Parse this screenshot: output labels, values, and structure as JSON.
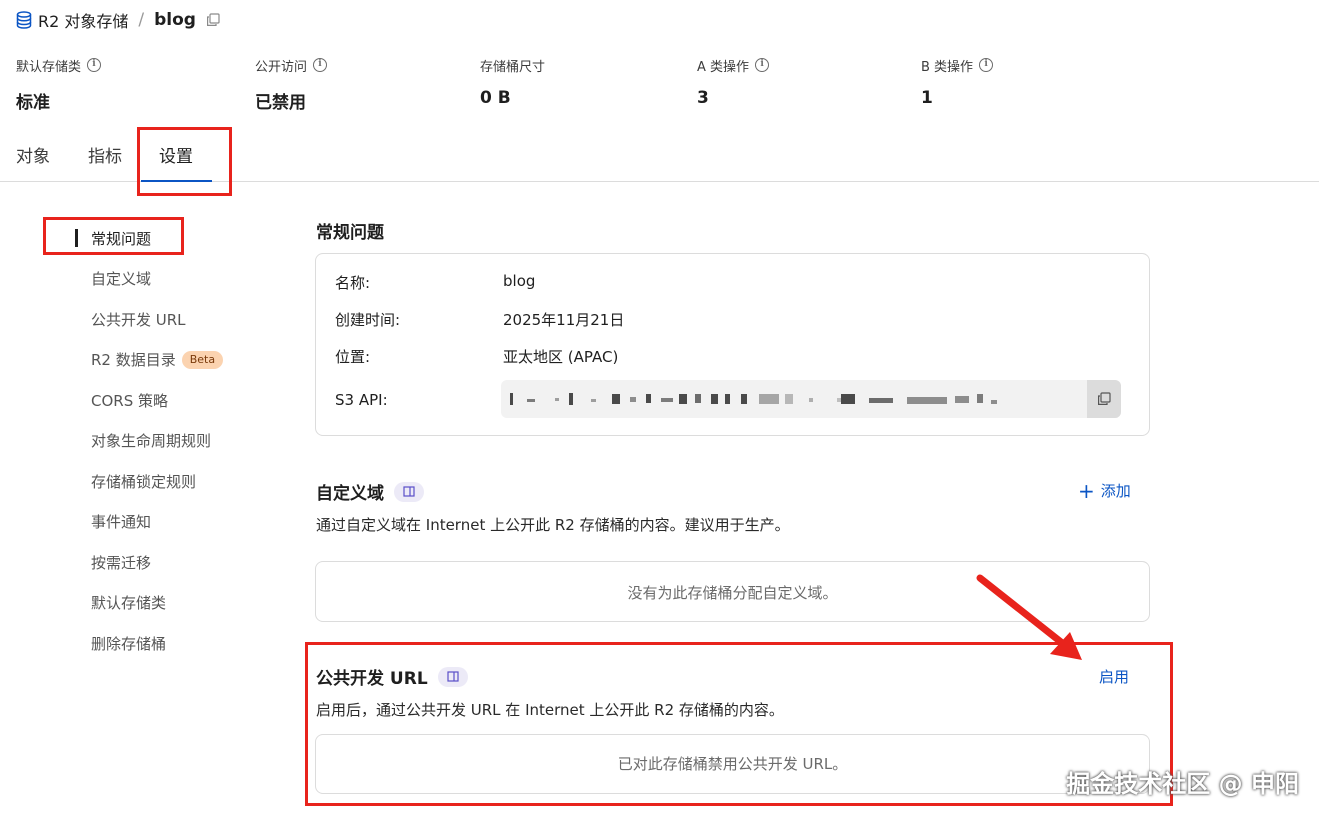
{
  "breadcrumb": {
    "parent": "R2 对象存储",
    "separator": "/",
    "current": "blog"
  },
  "stats": [
    {
      "label": "默认存储类",
      "value": "标准",
      "has_info": true
    },
    {
      "label": "公开访问",
      "value": "已禁用",
      "has_info": true
    },
    {
      "label": "存储桶尺寸",
      "value": "0 B",
      "has_info": false
    },
    {
      "label": "A 类操作",
      "value": "3",
      "has_info": true
    },
    {
      "label": "B 类操作",
      "value": "1",
      "has_info": true
    }
  ],
  "tabs": [
    {
      "label": "对象",
      "active": false
    },
    {
      "label": "指标",
      "active": false
    },
    {
      "label": "设置",
      "active": true
    }
  ],
  "sidenav": {
    "items": [
      {
        "label": "常规问题",
        "active": true
      },
      {
        "label": "自定义域"
      },
      {
        "label": "公共开发 URL"
      },
      {
        "label": "R2 数据目录",
        "badge": "Beta"
      },
      {
        "label": "CORS 策略"
      },
      {
        "label": "对象生命周期规则"
      },
      {
        "label": "存储桶锁定规则"
      },
      {
        "label": "事件通知"
      },
      {
        "label": "按需迁移"
      },
      {
        "label": "默认存储类"
      },
      {
        "label": "删除存储桶"
      }
    ]
  },
  "general": {
    "title": "常规问题",
    "rows": [
      {
        "label": "名称:",
        "value": "blog"
      },
      {
        "label": "创建时间:",
        "value": "2025年11月21日"
      },
      {
        "label": "位置:",
        "value": "亚太地区 (APAC)"
      },
      {
        "label": "S3 API:",
        "value": ""
      }
    ]
  },
  "custom_domain": {
    "title": "自定义域",
    "action": "添加",
    "description": "通过自定义域在 Internet 上公开此 R2 存储桶的内容。建议用于生产。",
    "empty": "没有为此存储桶分配自定义域。"
  },
  "public_dev_url": {
    "title": "公共开发 URL",
    "action": "启用",
    "description": "启用后，通过公共开发 URL 在 Internet 上公开此 R2 存储桶的内容。",
    "empty": "已对此存储桶禁用公共开发 URL。"
  },
  "watermark": "掘金技术社区 @ 申阳",
  "colors": {
    "accent": "#0b55c4",
    "annotation_red": "#e8231c",
    "beta_bg": "#fbd3b0"
  },
  "icons": {
    "breadcrumb": "database-icon",
    "copy": "copy-icon",
    "info": "info-icon",
    "doc": "doc-icon",
    "add": "plus-icon"
  }
}
